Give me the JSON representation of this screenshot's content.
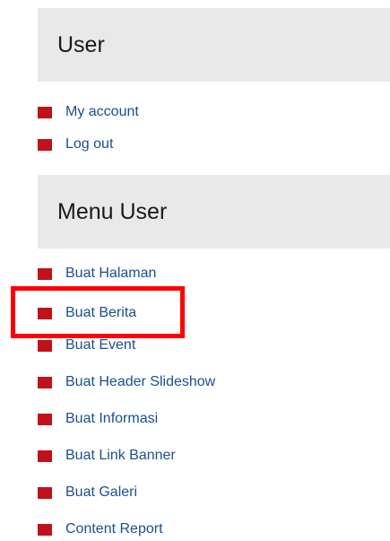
{
  "user_block": {
    "title": "User",
    "items": [
      {
        "label": "My account"
      },
      {
        "label": "Log out"
      }
    ]
  },
  "menu_user_block": {
    "title": "Menu User",
    "items": [
      {
        "label": "Buat Halaman"
      },
      {
        "label": "Buat Berita"
      },
      {
        "label": "Buat Event"
      },
      {
        "label": "Buat Header Slideshow"
      },
      {
        "label": "Buat Informasi"
      },
      {
        "label": "Buat Link Banner"
      },
      {
        "label": "Buat Galeri"
      },
      {
        "label": "Content Report"
      }
    ]
  },
  "colors": {
    "bullet": "#c0121b",
    "link": "#1b4f8f",
    "header_bg": "#e9e9e9",
    "highlight": "#ff0000"
  }
}
